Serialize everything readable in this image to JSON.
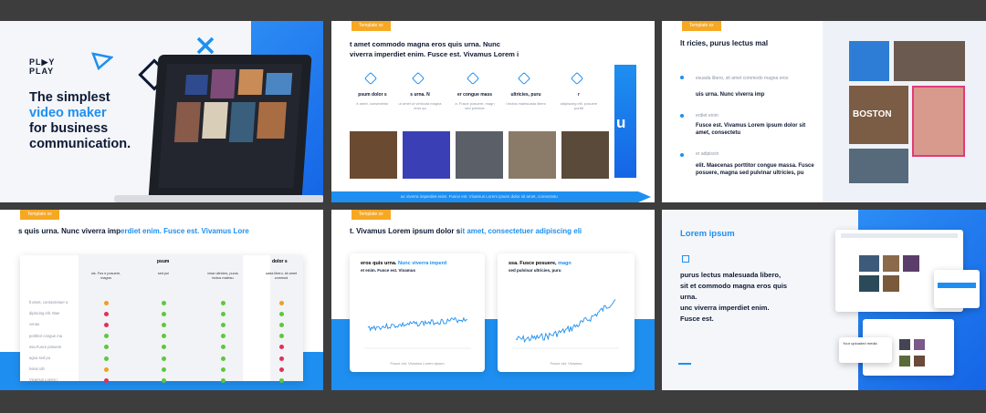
{
  "s1": {
    "logo_line1": "PL▶Y",
    "logo_line2": "PLAY",
    "headline_1": "The simplest",
    "headline_2": "video maker",
    "headline_3": "for business",
    "headline_4": "communication."
  },
  "s2": {
    "tag": "Template xx",
    "title_1": "t amet commodo magna eros quis urna. Nunc",
    "title_2": "viverra imperdiet enim. Fusce est. Vivamus Lorem i",
    "features": [
      {
        "title": "psum dolor s",
        "desc": "it amet, consectetur"
      },
      {
        "title": "s urna. N",
        "desc": "ut amet ut vehicula magna eros qu"
      },
      {
        "title": "er congue mass",
        "desc": "a. Fusce posuere, magn sed pulvinar"
      },
      {
        "title": "ultricies, puru",
        "desc": "l lectus malesuada libero"
      },
      {
        "title": "r",
        "desc": "adipiscing elit. posuere porttit"
      }
    ],
    "footer": "ac viverra imperdiet enim. Fusce est. Vivamus Lorem ipsum dolor sit amet, consectetu",
    "side_letter": "u"
  },
  "s3": {
    "tag": "Template xx",
    "title": "lt   ricies, purus lectus mal",
    "b1_small": "esuada libero, sit amet commodo magna eros",
    "b1_bold": "uis urna. Nunc viverra imp",
    "b2_small": "erdiet enim",
    "b2_bold": "Fusce est. Vivamus Lorem ipsum dolor sit amet, consectetu",
    "b3_small": "er adipiscin",
    "b3_bold": "elit. Maecenas porttitor congue massa. Fusce posuere, magna sed pulvinar ultricies, pu",
    "img_label": "BOSTON"
  },
  "s4": {
    "tag": "Template xx",
    "title_a": "s quis urna. Nunc viverra imp",
    "title_b": "erdiet enim. Fusce est. Vivamus Lore",
    "col_header_1": "psum",
    "col_header_2": "dolor s",
    "sub_headers": [
      "uis. Fus e posuere, magna",
      "sed pul",
      "vinar ultricies, purus lectus malesu",
      "uada libero, sit amet commod"
    ],
    "rows": [
      {
        "label": "lt amet, consectetuer a",
        "dots": [
          "#f0a020",
          "#5cc93b",
          "#5cc93b",
          "#f0a020"
        ]
      },
      {
        "label": "dipiscing elit. Mae",
        "dots": [
          "#e0305a",
          "#5cc93b",
          "#5cc93b",
          "#5cc93b"
        ]
      },
      {
        "label": "cenas",
        "dots": [
          "#e0305a",
          "#5cc93b",
          "#5cc93b",
          "#5cc93b"
        ]
      },
      {
        "label": "porttitor congue ma",
        "dots": [
          "#5cc93b",
          "#5cc93b",
          "#5cc93b",
          "#5cc93b"
        ]
      },
      {
        "label": "ssa.Fusce posuere",
        "dots": [
          "#5cc93b",
          "#5cc93b",
          "#5cc93b",
          "#e0305a"
        ]
      },
      {
        "label": "agna sed pu",
        "dots": [
          "#5cc93b",
          "#5cc93b",
          "#5cc93b",
          "#e0305a"
        ]
      },
      {
        "label": "lvinar ultr",
        "dots": [
          "#f0a020",
          "#5cc93b",
          "#5cc93b",
          "#e0305a"
        ]
      },
      {
        "label": "Vivamus Lorem i",
        "dots": [
          "#e0305a",
          "#5cc93b",
          "#5cc93b",
          "#5cc93b"
        ]
      }
    ]
  },
  "s5": {
    "tag": "Template xx",
    "title_a": "t. Vivamus Lorem ipsum dolor s",
    "title_b": "it amet, consectetuer adipiscing eli",
    "card1_title_a": "eros quis urna. ",
    "card1_title_b": "Nunc viverra imperd",
    "card1_sub": "et enim. Fusce est. Vivamus",
    "card1_footer": "Fusce est. Vivamus Lorem ipsum",
    "card2_title_a": "ssa. Fusce posuere, ",
    "card2_title_b": "magn",
    "card2_sub": "sed pulvinar ultricies, puru",
    "card2_footer": "Fusce est. Vivamus"
  },
  "s6": {
    "title": "Lorem ipsum",
    "body_1": "purus lectus malesuada libero,",
    "body_2": "sit et commodo magna eros quis",
    "body_3": "urna.",
    "body_4": "unc viverra imperdiet enim.",
    "body_5": "Fusce est.",
    "ui_caption": "Your uploaded media"
  }
}
